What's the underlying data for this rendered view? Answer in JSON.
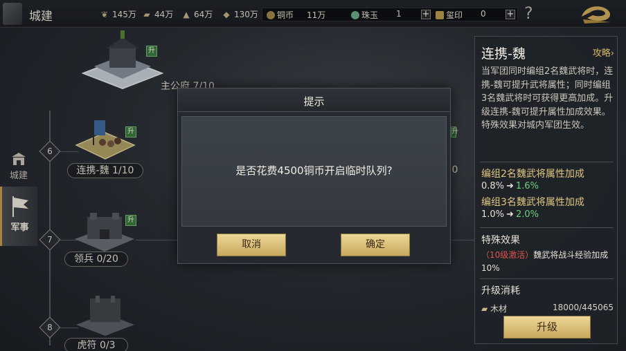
{
  "header": {
    "title": "城建",
    "resources": [
      {
        "icon": "wheat-icon",
        "value": "145万"
      },
      {
        "icon": "wood-icon",
        "value": "44万"
      },
      {
        "icon": "stone-icon",
        "value": "64万"
      },
      {
        "icon": "iron-icon",
        "value": "130万"
      }
    ],
    "currencies": {
      "copper": {
        "label": "铜币",
        "value": "11万"
      },
      "jade": {
        "label": "珠玉",
        "value": "1"
      },
      "seal": {
        "label": "玺印",
        "value": "0"
      }
    },
    "help_label": "?"
  },
  "nav": {
    "city_label": "城建",
    "military_label": "军事"
  },
  "buildings": {
    "main": {
      "label": "主公府 7/10",
      "up_badge": "升"
    },
    "lianxie": {
      "level": "6",
      "label": "连携-魏 1/10",
      "up_badge": "升",
      "side_value": "0",
      "side_badge": "升"
    },
    "lingbing": {
      "level": "7",
      "label": "领兵 0/20",
      "up_badge": "升"
    },
    "hufu": {
      "level": "8",
      "label": "虎符 0/3"
    }
  },
  "dialog": {
    "title": "提示",
    "message": "是否花费4500铜币开启临时队列?",
    "cancel_label": "取消",
    "confirm_label": "确定"
  },
  "panel": {
    "title": "连携-魏",
    "guide_link": "攻略",
    "description": "当军团同时编组2名魏武将时，连携-魏可提升武将属性；同时编组3名魏武将时可获得更高加成。升级连携-魏可提升属性加成效果。特殊效果对城内军团生效。",
    "bonus2_heading": "编组2名魏武将属性加成",
    "bonus2_current": "0.8%",
    "bonus2_next": "1.6%",
    "bonus3_heading": "编组3名魏武将属性加成",
    "bonus3_current": "1.0%",
    "bonus3_next": "2.0%",
    "special_heading": "特殊效果",
    "special_activate": "（10级激活）",
    "special_text": "魏武将战斗经验加成10%",
    "cost_heading": "升级消耗",
    "cost_item": "木材",
    "cost_value": "18000/445065",
    "upgrade_label": "升级"
  },
  "colors": {
    "accent_gold": "#c9a24d",
    "increase_green": "#6bd07a",
    "activate_red": "#e0524a"
  }
}
